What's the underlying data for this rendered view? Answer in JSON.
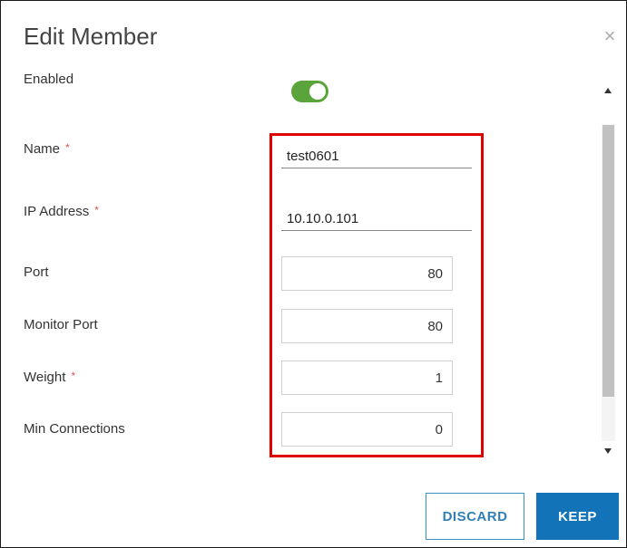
{
  "dialog": {
    "title": "Edit Member",
    "close_icon": "×"
  },
  "form": {
    "enabled": {
      "label": "Enabled",
      "value": true
    },
    "name": {
      "label": "Name",
      "required_marker": "*",
      "value": "test0601"
    },
    "ip_address": {
      "label": "IP Address",
      "required_marker": "*",
      "value": "10.10.0.101"
    },
    "port": {
      "label": "Port",
      "value": "80"
    },
    "monitor_port": {
      "label": "Monitor Port",
      "value": "80"
    },
    "weight": {
      "label": "Weight",
      "required_marker": "*",
      "value": "1"
    },
    "min_connections": {
      "label": "Min Connections",
      "value": "0"
    }
  },
  "buttons": {
    "discard_label": "DISCARD",
    "keep_label": "KEEP"
  },
  "colors": {
    "toggle_on": "#5ba43b",
    "primary": "#1273b8",
    "highlight": "#e00000",
    "required": "#d9534f"
  },
  "icons": {
    "close": "close-icon",
    "scroll_up": "chevron-up-icon",
    "scroll_down": "chevron-down-icon"
  }
}
